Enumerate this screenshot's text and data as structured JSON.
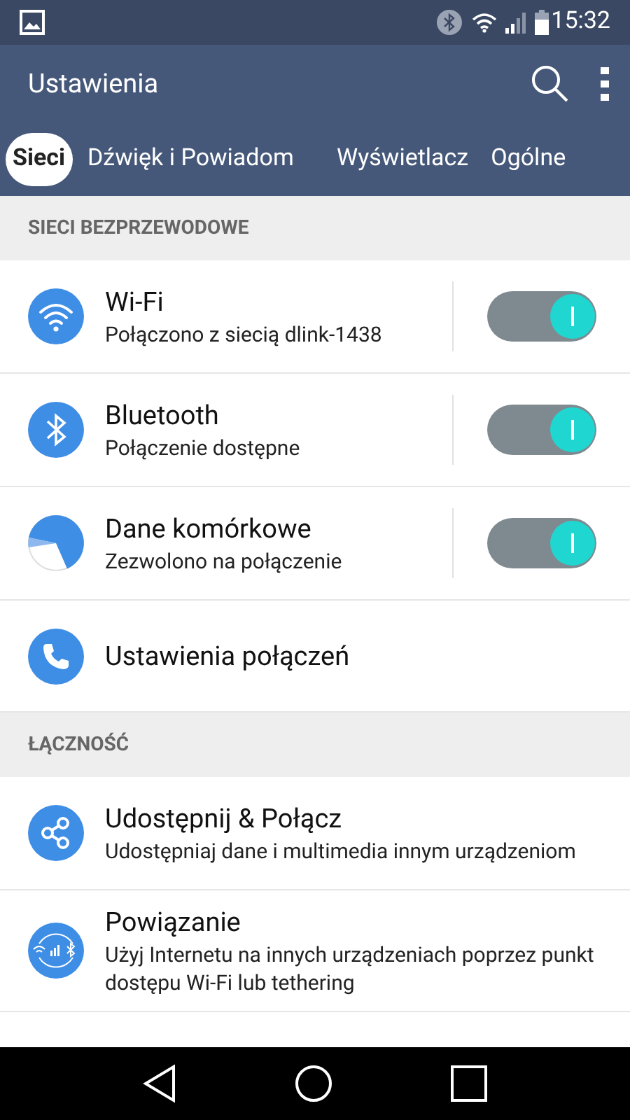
{
  "status_bar": {
    "time": "15:32"
  },
  "app_bar": {
    "title": "Ustawienia"
  },
  "tabs": [
    {
      "label": "Sieci",
      "selected": true
    },
    {
      "label": "Dźwięk i Powiadom",
      "selected": false
    },
    {
      "label": "Wyświetlacz",
      "selected": false
    },
    {
      "label": "Ogólne",
      "selected": false
    }
  ],
  "sections": [
    {
      "header": "SIECI BEZPRZEWODOWE",
      "items": [
        {
          "kind": "toggle",
          "title": "Wi-Fi",
          "subtitle": "Połączono z siecią dlink-1438",
          "on": true
        },
        {
          "kind": "toggle",
          "title": "Bluetooth",
          "subtitle": "Połączenie dostępne",
          "on": true
        },
        {
          "kind": "toggle",
          "title": "Dane komórkowe",
          "subtitle": "Zezwolono na połączenie",
          "on": true
        },
        {
          "kind": "plain",
          "title": "Ustawienia połączeń"
        }
      ]
    },
    {
      "header": "ŁĄCZNOŚĆ",
      "items": [
        {
          "kind": "plain",
          "title": "Udostępnij & Połącz",
          "subtitle": "Udostępniaj dane i multimedia innym urządzeniom"
        },
        {
          "kind": "plain",
          "title": "Powiązanie",
          "subtitle": "Użyj Internetu na innych urządzeniach poprzez punkt dostępu Wi-Fi lub tethering"
        }
      ]
    }
  ]
}
